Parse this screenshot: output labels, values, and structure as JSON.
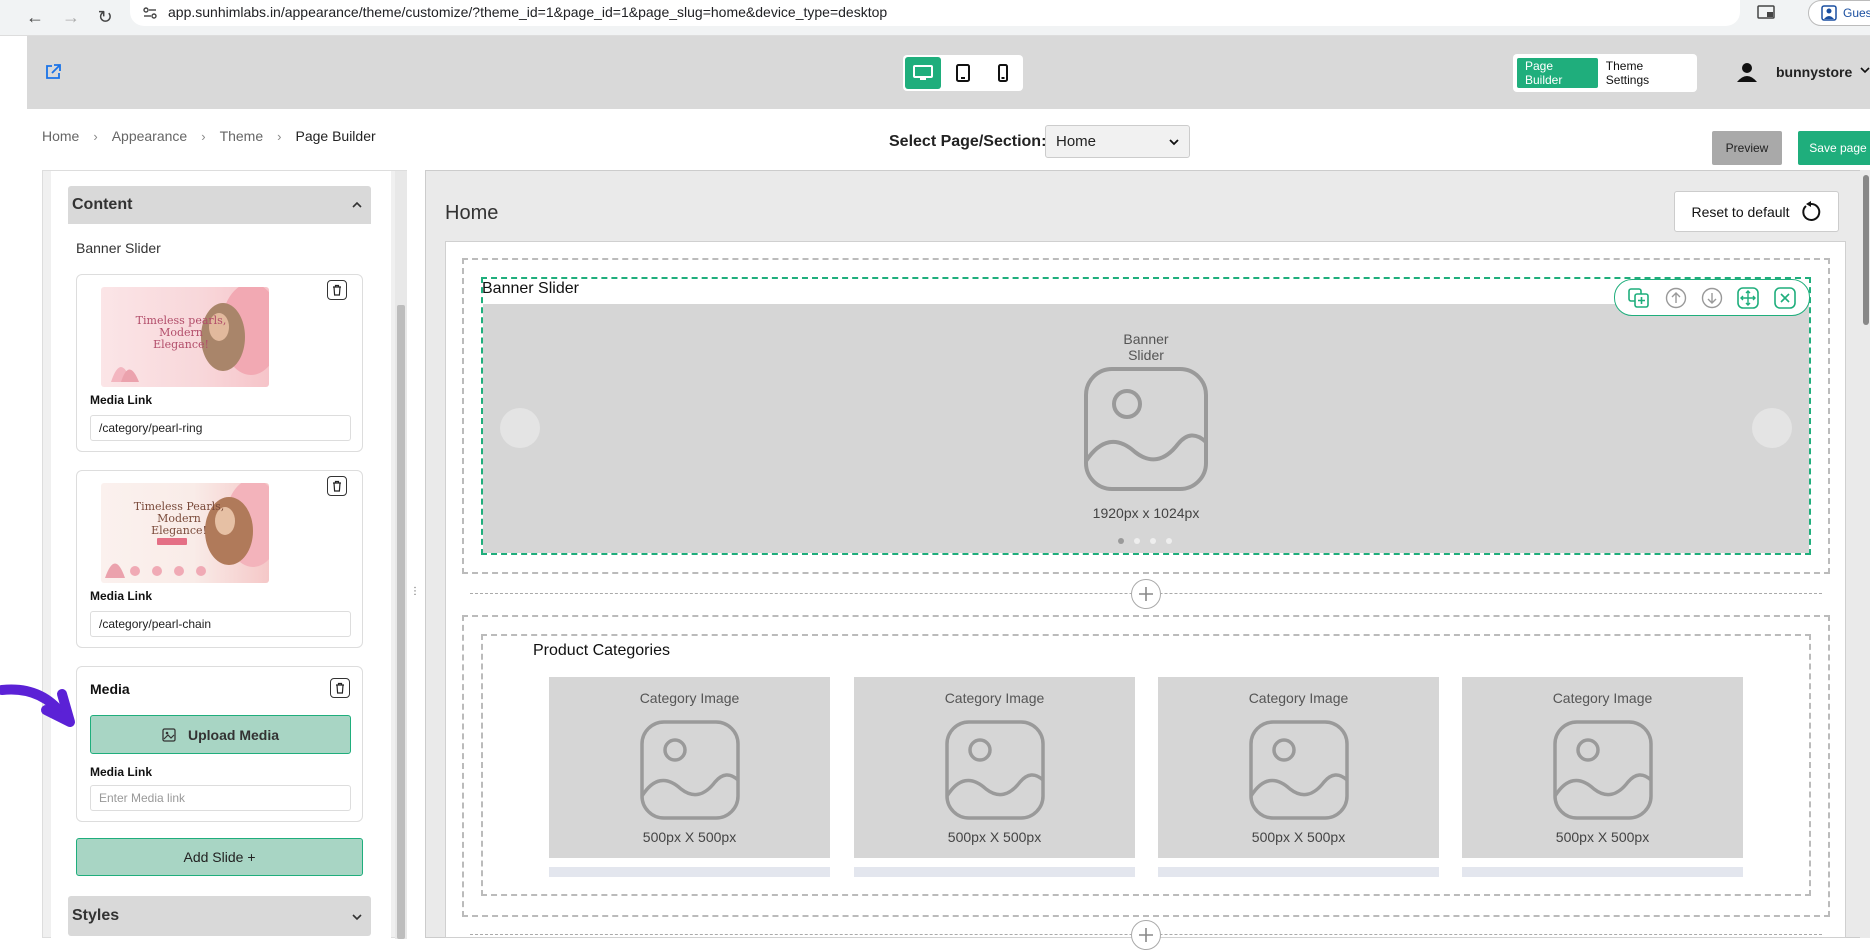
{
  "browser": {
    "url": "app.sunhimlabs.in/appearance/theme/customize/?theme_id=1&page_id=1&page_slug=home&device_type=desktop",
    "profile_label": "Guest"
  },
  "header": {
    "modes": [
      "Page Builder",
      "Theme Settings"
    ],
    "active_mode": "Page Builder",
    "username": "bunnystore",
    "devices": [
      "desktop-icon",
      "tablet-icon",
      "mobile-icon"
    ],
    "active_device": "desktop"
  },
  "breadcrumb": [
    "Home",
    "Appearance",
    "Theme",
    "Page Builder"
  ],
  "page_select": {
    "label": "Select Page/Section:",
    "value": "Home"
  },
  "actions": {
    "preview": "Preview",
    "save": "Save page"
  },
  "left_panel": {
    "content_title": "Content",
    "section_title": "Banner Slider",
    "slides": [
      {
        "link_label": "Media Link",
        "link_value": "/category/pearl-ring",
        "thumb_text": "Timeless pearls, Modern Elegance!"
      },
      {
        "link_label": "Media Link",
        "link_value": "/category/pearl-chain",
        "thumb_text": "Timeless Pearls, Modern Elegance!"
      }
    ],
    "empty_slide": {
      "title": "Media",
      "upload_label": "Upload Media",
      "link_label": "Media Link",
      "link_placeholder": "Enter Media link"
    },
    "add_slide": "Add Slide +",
    "styles_title": "Styles"
  },
  "canvas": {
    "page_title": "Home",
    "reset_label": "Reset to default",
    "banner": {
      "label": "Banner Slider",
      "center_title": "Banner Slider",
      "size": "1920px x 1024px"
    },
    "categories": {
      "title": "Product Categories",
      "items": [
        {
          "title": "Category Image",
          "size": "500px X 500px"
        },
        {
          "title": "Category Image",
          "size": "500px X 500px"
        },
        {
          "title": "Category Image",
          "size": "500px X 500px"
        },
        {
          "title": "Category Image",
          "size": "500px X 500px"
        }
      ]
    }
  },
  "colors": {
    "accent": "#1fae7c",
    "accent_light": "#a8d5c4",
    "header_bg": "#d9d9d9",
    "annotation": "#5b21d6"
  }
}
